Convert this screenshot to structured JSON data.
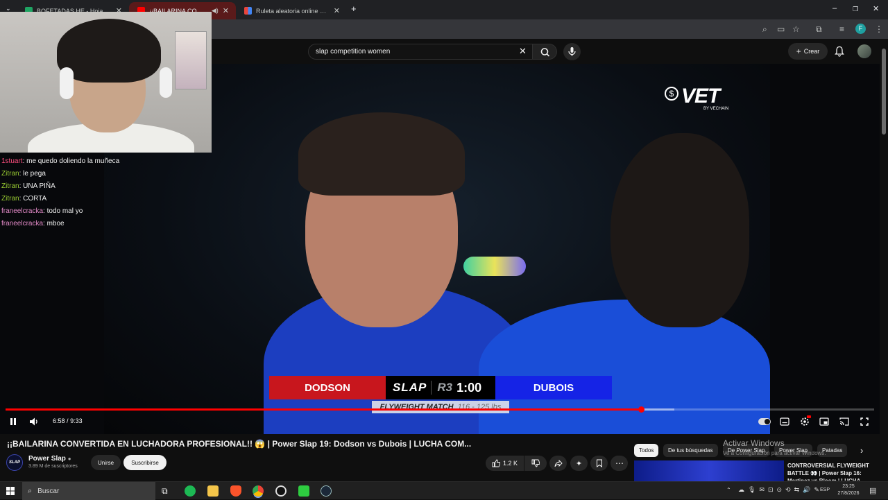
{
  "browser": {
    "tabs": [
      {
        "title": "BOFETADAS HE - Hojas de cálc",
        "favicon_color": "#1fa463",
        "active": false
      },
      {
        "title": "¡¡BAILARINA CONVERTIDA",
        "favicon_color": "#ff0000",
        "active": true
      },
      {
        "title": "Ruleta aleatoria online – ruleta",
        "favicon_color": "#e8453c",
        "active": false
      }
    ],
    "new_tab": "+",
    "profile_initial": "F"
  },
  "youtube": {
    "search_value": "slap competition women",
    "create_label": "Crear"
  },
  "video": {
    "sponsor_logo": "VET",
    "sponsor_sub": "BY VECHAIN",
    "sponsor_coin": "$",
    "scoreboard": {
      "red_name": "DODSON",
      "logo": "SLAP",
      "round": "R3",
      "clock": "1:00",
      "blue_name": "DUBOIS",
      "match": "FLYWEIGHT MATCH",
      "weight": "116 - 125 lbs"
    },
    "time_current": "6:58",
    "time_total": "9:33",
    "progress": 0.7315,
    "buffered": 0.77
  },
  "chat": [
    {
      "user": "1stuart",
      "color": "#ff4f7f",
      "text": "me quedo doliendo la muñeca"
    },
    {
      "user": "Zitran",
      "color": "#9acd32",
      "text": "le pega"
    },
    {
      "user": "Zitran",
      "color": "#9acd32",
      "text": "UNA PIÑA"
    },
    {
      "user": "Zitran",
      "color": "#9acd32",
      "text": "CORTA"
    },
    {
      "user": "franeelcracka",
      "color": "#e28ac8",
      "text": "todo mal yo"
    },
    {
      "user": "franeelcracka",
      "color": "#e28ac8",
      "text": "mboe"
    }
  ],
  "details": {
    "title": "¡¡BAILARINA CONVERTIDA EN LUCHADORA PROFESIONAL!! 😱 | Power Slap 19: Dodson vs Dubois | LUCHA COM...",
    "channel_name": "Power Slap",
    "channel_avatar_text": "SLAP",
    "subscribers": "3.89 M de suscriptores",
    "join_label": "Unirse",
    "subscribe_label": "Suscribirse",
    "likes": "1.2 K"
  },
  "recommendations": {
    "chips": [
      "Todos",
      "De tus búsquedas",
      "De Power Slap",
      "Power Slap",
      "Patadas"
    ],
    "first_title": "CONTROVERSIAL FLYWEIGHT BATTLE 👀 | Power Slap 16: Martinez vs Bloom | LUCHA..."
  },
  "watermark": {
    "line1": "Activar Windows",
    "line2": "Ve a Configuración para activar Windows."
  },
  "taskbar": {
    "search_placeholder": "Buscar",
    "lang": "ESP",
    "time": "23:25",
    "date": "27/8/2026"
  }
}
